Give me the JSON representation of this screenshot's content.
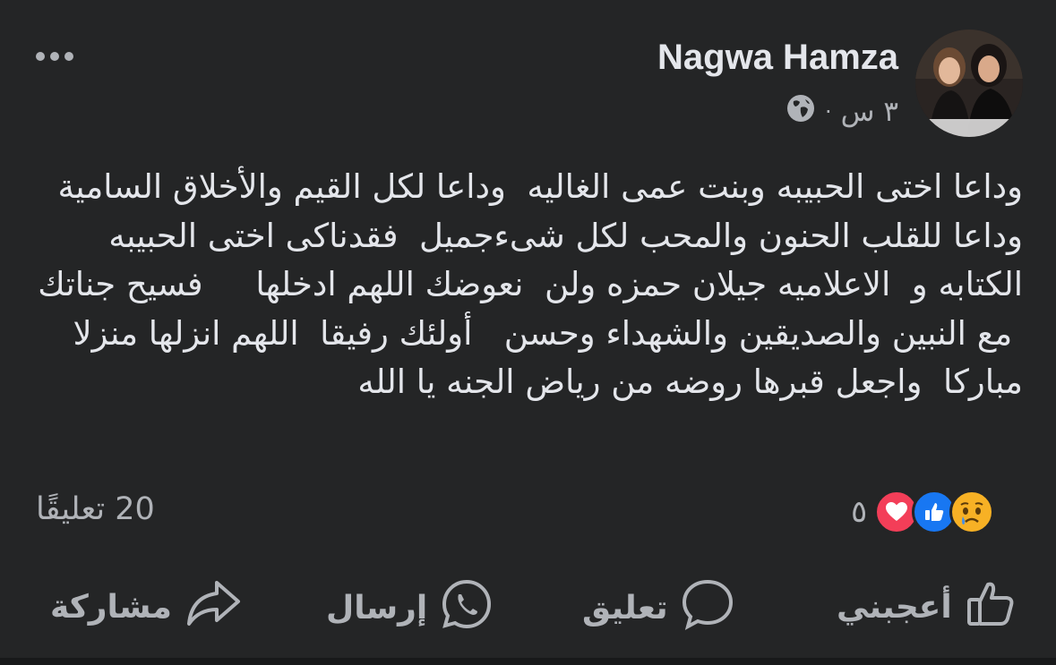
{
  "post": {
    "author": "Nagwa Hamza",
    "time": "٣ س",
    "separator": "·",
    "privacy_icon": "globe-icon",
    "more_icon": "more-options-icon",
    "text": "وداعا اختى الحبيبه وبنت عمى الغاليه  وداعا لكل القيم والأخلاق السامية وداعا للقلب الحنون والمحب لكل شىءجميل  فقدناكى اختى الحبيبه الكتابه و  الاعلاميه جيلان حمزه ولن  نعوضك اللهم ادخلها     فسيح جناتك\n مع النبين والصديقين والشهداء وحسن   أولئك رفيقا  اللهم انزلها منزلا مباركا  واجعل قبرها روضه من رياض الجنه يا الله"
  },
  "stats": {
    "comments": "20 تعليقًا",
    "reactions_count": "٥",
    "reactions": [
      "love",
      "like",
      "sad"
    ]
  },
  "actions": {
    "like": "أعجبني",
    "comment": "تعليق",
    "send": "إرسال",
    "share": "مشاركة"
  },
  "colors": {
    "background": "#242526",
    "text": "#e4e6eb",
    "secondary": "#b0b3b8",
    "like_blue": "#1877f2",
    "love_red": "#f33e58",
    "sad_yellow": "#f7b125"
  }
}
